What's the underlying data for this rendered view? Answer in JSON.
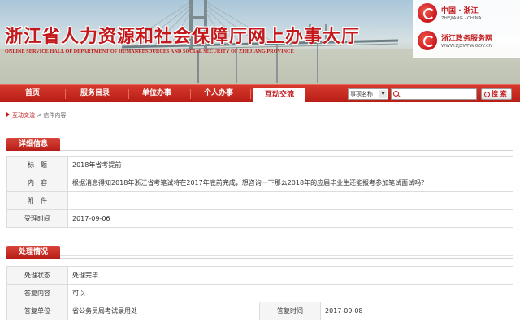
{
  "header": {
    "title_cn": "浙江省人力资源和社会保障厅网上办事大厅",
    "title_en": "ONLINE SERVICE HALL OF DEPARTMENT OF HUMANRESOURCES AND SOCIAL SECURITY OF ZHEJIANG PROVINCE",
    "logo1_title": "中国 · 浙江",
    "logo1_sub": "ZHEJIANG · CHINA",
    "logo2_title": "浙江政务服务网",
    "logo2_sub": "WWW.ZJZWFW.GOV.CN"
  },
  "nav": {
    "items": [
      {
        "label": "首页"
      },
      {
        "label": "服务目录"
      },
      {
        "label": "单位办事"
      },
      {
        "label": "个人办事"
      },
      {
        "label": "互动交流"
      }
    ],
    "active_index": 4,
    "search_select": "事项名称",
    "search_input": "",
    "search_button": "搜 索"
  },
  "breadcrumb": {
    "link": "互动交流",
    "separator": ">",
    "current": "信件内容"
  },
  "detail": {
    "heading": "详细信息",
    "title_label": "标　题",
    "title_value": "2018年省考提前",
    "content_label": "内　容",
    "content_value": "根据消息得知2018年浙江省考笔试将在2017年底前完成，想咨询一下那么2018年的应届毕业生还能报考参加笔试面试吗？",
    "attachment_label": "附　件",
    "attachment_value": "",
    "received_label": "受理时间",
    "received_value": "2017-09-06"
  },
  "handling": {
    "heading": "处理情况",
    "status_label": "处理状态",
    "status_value": "处理完毕",
    "reply_label": "答复内容",
    "reply_value": "可以",
    "unit_label": "答复单位",
    "unit_value": "省公务员局考试录用处",
    "time_label": "答复时间",
    "time_value": "2017-09-08"
  },
  "colors": {
    "brand_red": "#c3191c",
    "nav_top": "#d63a2d",
    "nav_bottom": "#b81d16"
  }
}
